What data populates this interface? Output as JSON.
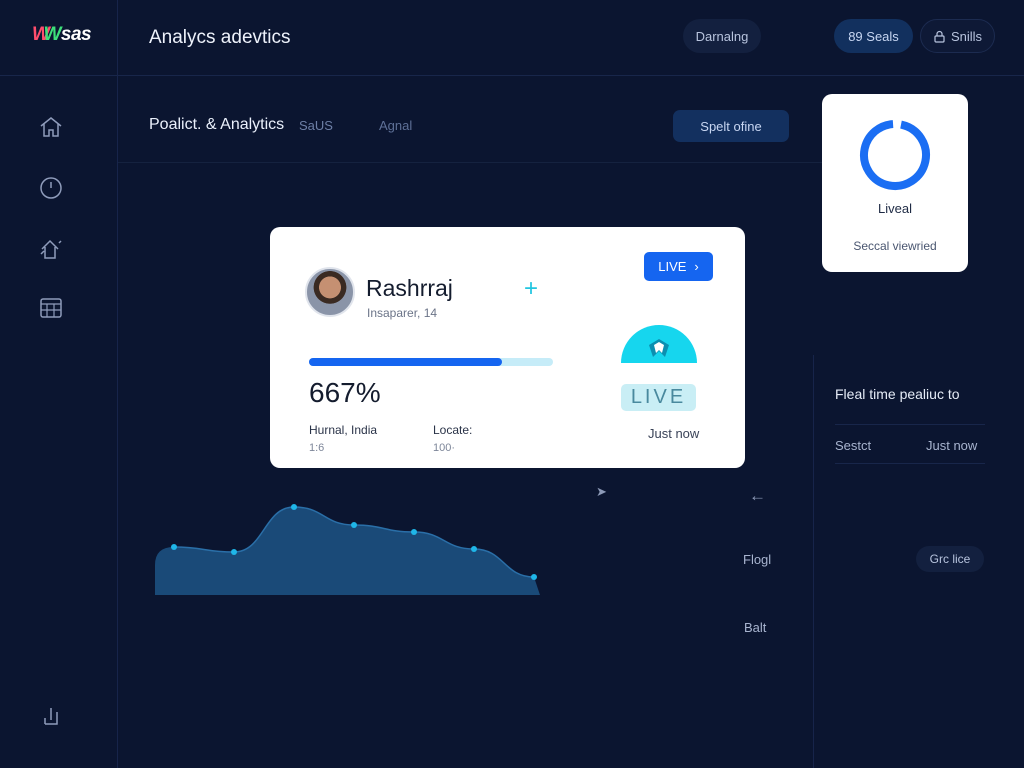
{
  "header": {
    "logo": {
      "part1": "W",
      "part2": "sas"
    },
    "title": "Analycs adevtics",
    "pill_a": "Darnalng",
    "pill_b": "89 Seals",
    "pill_c": "Snills"
  },
  "sidebar": {
    "items": [
      {
        "icon": "home-icon"
      },
      {
        "icon": "clock-icon"
      },
      {
        "icon": "house-arrows-icon"
      },
      {
        "icon": "calendar-icon"
      },
      {
        "icon": "export-icon"
      }
    ]
  },
  "section": {
    "title": "Poalict. & Analytics",
    "tag": "SaUS",
    "sub": "Agnal",
    "action": "Spelt ofine"
  },
  "status_card": {
    "label": "Liveal",
    "sub": "Seccal viewried",
    "ring_color": "#1b6ef3"
  },
  "profile_card": {
    "name": "Rashrraj",
    "subtitle": "Insaparer, 14",
    "live_button": "LIVE",
    "progress": 0.79,
    "percent_text": "667%",
    "meta_a_label": "Hurnal, India",
    "meta_a_value": "1:6",
    "meta_b_label": "Locate:",
    "meta_b_value": "100·",
    "live_badge": "LIVE",
    "time": "Just now",
    "accent": "#1565f0"
  },
  "chart_data": {
    "type": "area",
    "x": [
      1,
      2,
      3,
      4,
      5,
      6,
      7
    ],
    "values": [
      48,
      43,
      88,
      70,
      63,
      46,
      18
    ],
    "ylim": [
      0,
      100
    ],
    "title": "",
    "xlabel": "",
    "ylabel": "",
    "grid": false
  },
  "right_panel": {
    "title": "Fleal time pealiuc to",
    "row_left": "Sestct",
    "row_right": "Just now",
    "flog": "Flogl",
    "bait": "Balt",
    "pill": "Grc lice"
  }
}
